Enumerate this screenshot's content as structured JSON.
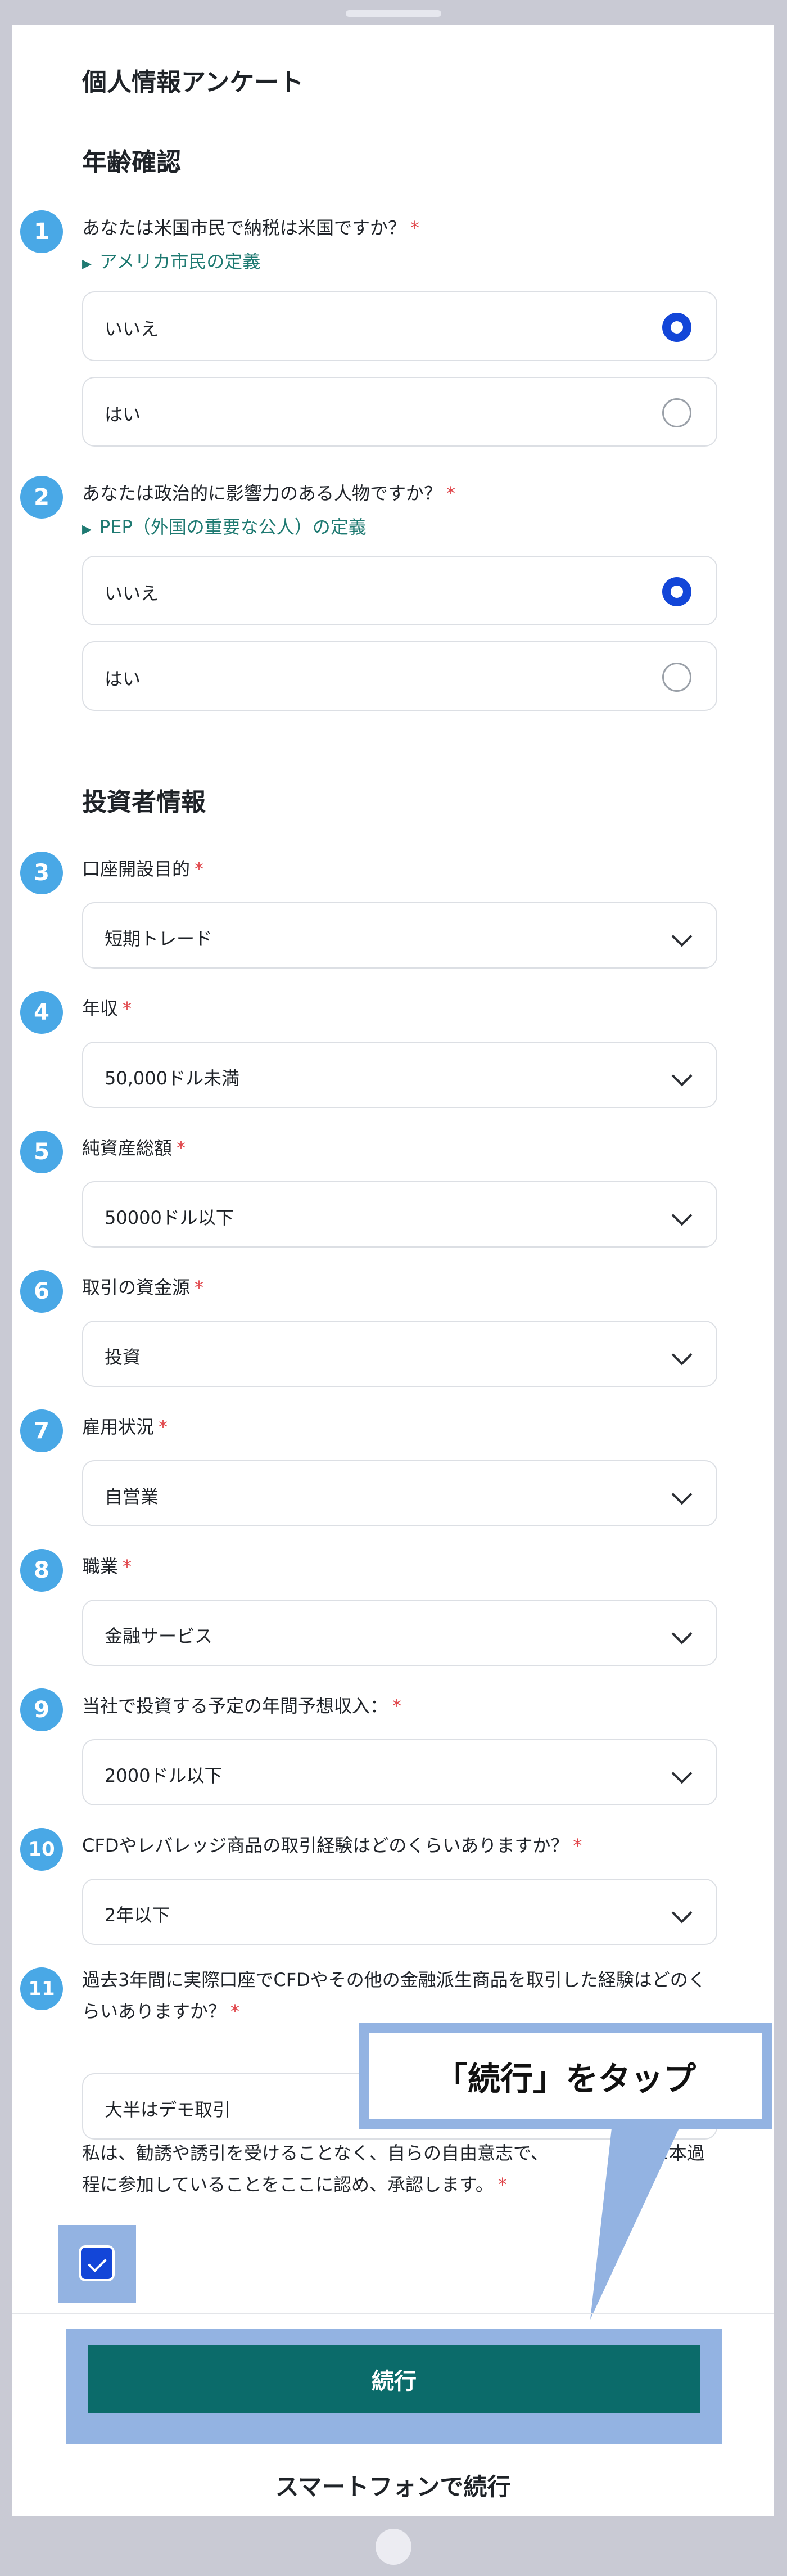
{
  "page_title": "個人情報アンケート",
  "sections": {
    "age": "年齢確認",
    "investor": "投資者情報"
  },
  "q1": {
    "badge": "1",
    "label": "あなたは米国市民で納税は米国ですか？",
    "required": "*",
    "link": "アメリカ市民の定義",
    "options": [
      {
        "label": "いいえ",
        "selected": true
      },
      {
        "label": "はい",
        "selected": false
      }
    ]
  },
  "q2": {
    "badge": "2",
    "label": "あなたは政治的に影響力のある人物ですか？",
    "required": "*",
    "link": "PEP（外国の重要な公人）の定義",
    "options": [
      {
        "label": "いいえ",
        "selected": true
      },
      {
        "label": "はい",
        "selected": false
      }
    ]
  },
  "fields": [
    {
      "badge": "3",
      "label": "口座開設目的",
      "required": "*",
      "value": "短期トレード"
    },
    {
      "badge": "4",
      "label": "年収",
      "required": "*",
      "value": "50,000ドル未満"
    },
    {
      "badge": "5",
      "label": "純資産総額",
      "required": "*",
      "value": "50000ドル以下"
    },
    {
      "badge": "6",
      "label": "取引の資金源",
      "required": "*",
      "value": "投資"
    },
    {
      "badge": "7",
      "label": "雇用状況",
      "required": "*",
      "value": "自営業"
    },
    {
      "badge": "8",
      "label": "職業",
      "required": "*",
      "value": "金融サービス"
    },
    {
      "badge": "9",
      "label": "当社で投資する予定の年間予想収入：",
      "required": "*",
      "value": "2000ドル以下"
    },
    {
      "badge": "10",
      "label": "CFDやレバレッジ商品の取引経験はどのくらいありますか？",
      "required": "*",
      "value": "2年以下"
    },
    {
      "badge": "11",
      "label": "過去3年間に実際口座でCFDやその他の金融派生商品を取引した経験はどのくらいありますか？",
      "required": "*",
      "value": "大半はデモ取引"
    }
  ],
  "consent": {
    "text_before": "私は、勧誘や誘引を受けることなく、自らの自由意志で、",
    "text_after": "的に本過程に参加していることをここに認め、承認します。",
    "required": "*",
    "checked": true
  },
  "continue_label": "続行",
  "smartphone_label": "スマートフォンで続行",
  "callout_text": "「続行」をタップ",
  "colors": {
    "accent": "#1346d8",
    "primary_button": "#0b6b6a",
    "badge": "#49a8e6",
    "highlight": "#93b3e2",
    "link": "#1f7a72",
    "required": "#e0454a"
  }
}
